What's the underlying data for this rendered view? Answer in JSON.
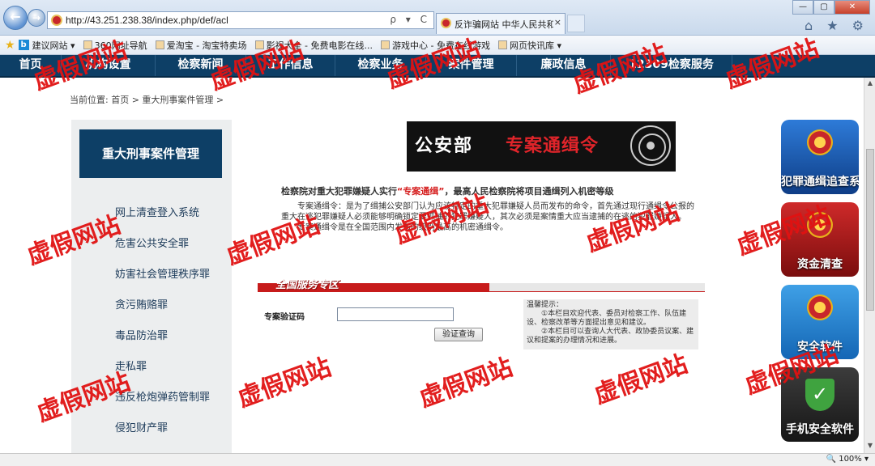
{
  "browser": {
    "url": "http://43.251.238.38/index.php/def/acl",
    "tab_title": "反诈骗网站 中华人民共和...",
    "tab_close": "×",
    "back_icon": "arrow-left-icon",
    "forward_icon": "arrow-right-icon",
    "address_controls": "ρ ▾ C",
    "win_min": "—",
    "win_max": "▢",
    "win_close": "✕",
    "tools": "⌂ ★ ⚙",
    "favorites": [
      "建议网站 ▾",
      "360网址导航",
      "爱淘宝 - 淘宝特卖场",
      "影视大全 - 免费电影在线...",
      "游戏中心 - 免费在线游戏",
      "网页快讯库 ▾"
    ],
    "zoom": "🔍 100% ▾"
  },
  "site_nav": [
    "首页",
    "机构设置",
    "检察新闻",
    "工作信息",
    "检察业务",
    "案件管理",
    "廉政信息",
    "12309检察服务"
  ],
  "breadcrumb": "当前位置: 首页 > 重大刑事案件管理 >",
  "sidebar": {
    "title": "重大刑事案件管理",
    "items": [
      "网上清查登入系统",
      "危害公共安全罪",
      "妨害社会管理秩序罪",
      "贪污贿赂罪",
      "毒品防治罪",
      "走私罪",
      "违反枪炮弹药管制罪",
      "侵犯财产罪"
    ]
  },
  "banner": {
    "text_white": "公安部",
    "text_red": "专案通缉令"
  },
  "intro": {
    "heading_before": "检察院对重大犯罪嫌疑人实行",
    "heading_red": "“专案通缉”",
    "heading_after": "，最高人民检察院将项目通缉列入机密等级",
    "para1": "专案通缉令：是为了缉捕公安部门认为应该特定的重大犯罪嫌疑人员而发布的命令，首先通过现行通缉令公报的重大在逃犯罪嫌疑人必须能够明确锁定要抓捕的犯罪嫌疑人，其次必须是案情重大应当逮捕的在逃的犯罪嫌疑人。",
    "para2": "专案通缉令是在全国范围内发布的级别最高的机密通缉令。"
  },
  "service": {
    "title": "全国服务专区",
    "field_label": "专案验证码",
    "field_value": "",
    "button": "验证查询"
  },
  "tips": {
    "title": "温馨提示：",
    "line1": "①本栏目欢迎代表、委员对检察工作、队伍建设、检察改革等方面提出意见和建议。",
    "line2": "②本栏目可以查询人大代表、政协委员议案、建议和提案的办理情况和进展。"
  },
  "side_icons": [
    "犯罪通缉追查系统",
    "资金清查",
    "安全软件",
    "手机安全软件"
  ],
  "watermark": "虚假网站"
}
